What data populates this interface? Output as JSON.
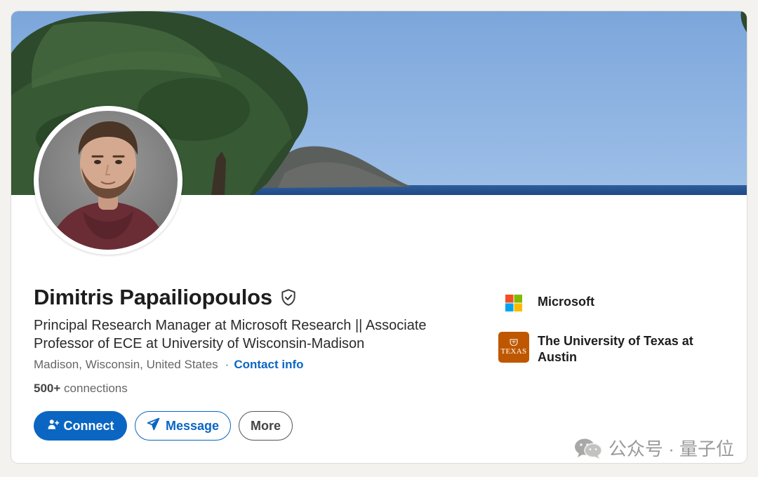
{
  "profile": {
    "name": "Dimitris Papailiopoulos",
    "headline": "Principal Research Manager at Microsoft Research || Associate Professor of ECE at University of Wisconsin-Madison",
    "location": "Madison, Wisconsin, United States",
    "separator": "·",
    "contact_info_label": "Contact info",
    "connections_count": "500+",
    "connections_label": "connections"
  },
  "actions": {
    "connect_label": "Connect",
    "message_label": "Message",
    "more_label": "More"
  },
  "organizations": [
    {
      "name": "Microsoft",
      "logo": "microsoft-logo"
    },
    {
      "name": "The University of Texas at Austin",
      "logo": "ut-austin-logo",
      "logo_text": "TEXAS"
    }
  ],
  "watermark": {
    "text": "公众号 · 量子位",
    "icon": "wechat-icon"
  },
  "colors": {
    "brand_blue": "#0a66c2",
    "texas_orange": "#bf5700",
    "ms_red": "#f25022",
    "ms_green": "#7fba00",
    "ms_blue": "#00a4ef",
    "ms_yellow": "#ffb900"
  }
}
